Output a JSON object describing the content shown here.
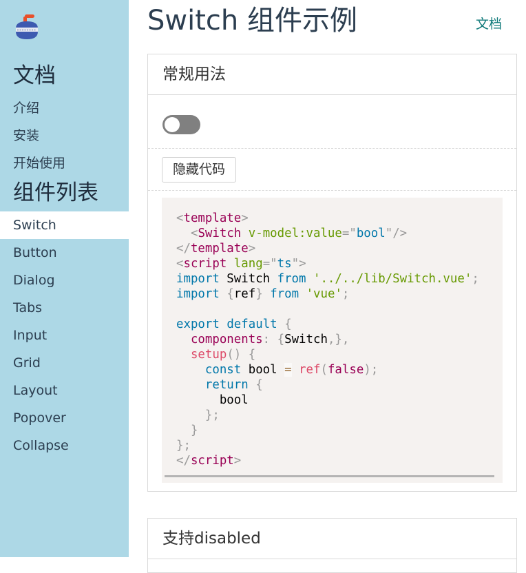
{
  "sidebar": {
    "logo_icon": "curling-stone-icon",
    "docs_title": "文档",
    "docs_items": [
      "介绍",
      "安装",
      "开始使用"
    ],
    "components_title": "组件列表",
    "component_items": [
      "Switch",
      "Button",
      "Dialog",
      "Tabs",
      "Input",
      "Grid",
      "Layout",
      "Popover",
      "Collapse"
    ],
    "active_item": "Switch"
  },
  "header": {
    "title": "Switch 组件示例",
    "doc_link": "文档"
  },
  "demo1": {
    "title": "常规用法",
    "switch_on": false,
    "toggle_code_label": "隐藏代码"
  },
  "demo2": {
    "title": "支持disabled"
  },
  "colors": {
    "sidebar_bg": "#add8e6",
    "switch_off": "#808080",
    "code_bg": "#f5f2f0",
    "link": "#0f7a7a"
  }
}
